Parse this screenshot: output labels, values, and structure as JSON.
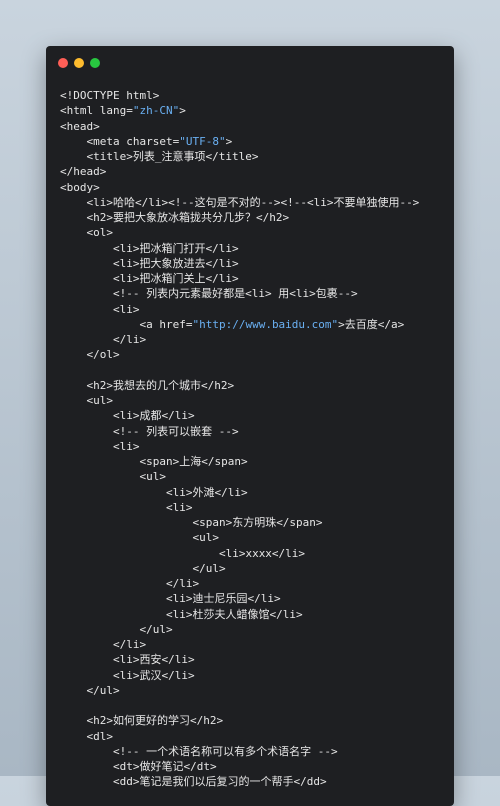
{
  "window": {
    "controls": {
      "close": "red-dot",
      "minimize": "yellow-dot",
      "maximize": "green-dot"
    },
    "colors": {
      "background": "#1e1f22",
      "text": "#e6e6e6",
      "string": "#6ab0f3"
    }
  },
  "code_lines": [
    {
      "indent": 0,
      "parts": [
        {
          "t": "<!DOCTYPE html>"
        }
      ]
    },
    {
      "indent": 0,
      "parts": [
        {
          "t": "<html lang="
        },
        {
          "t": "\"zh-CN\"",
          "s": 1
        },
        {
          "t": ">"
        }
      ]
    },
    {
      "indent": 0,
      "parts": [
        {
          "t": "<head>"
        }
      ]
    },
    {
      "indent": 1,
      "parts": [
        {
          "t": "<meta charset="
        },
        {
          "t": "\"UTF-8\"",
          "s": 1
        },
        {
          "t": ">"
        }
      ]
    },
    {
      "indent": 1,
      "parts": [
        {
          "t": "<title>列表_注意事项</title>"
        }
      ]
    },
    {
      "indent": 0,
      "parts": [
        {
          "t": "</head>"
        }
      ]
    },
    {
      "indent": 0,
      "parts": [
        {
          "t": "<body>"
        }
      ]
    },
    {
      "indent": 1,
      "parts": [
        {
          "t": "<li>哈哈</li><!--这句是不对的--><!--<li>不要单独使用-->"
        }
      ]
    },
    {
      "indent": 1,
      "parts": [
        {
          "t": "<h2>要把大象放冰箱拢共分几步？</h2>"
        }
      ]
    },
    {
      "indent": 1,
      "parts": [
        {
          "t": "<ol>"
        }
      ]
    },
    {
      "indent": 2,
      "parts": [
        {
          "t": "<li>把冰箱门打开</li>"
        }
      ]
    },
    {
      "indent": 2,
      "parts": [
        {
          "t": "<li>把大象放进去</li>"
        }
      ]
    },
    {
      "indent": 2,
      "parts": [
        {
          "t": "<li>把冰箱门关上</li>"
        }
      ]
    },
    {
      "indent": 2,
      "parts": [
        {
          "t": "<!-- 列表内元素最好都是<li> 用<li>包裹-->"
        }
      ]
    },
    {
      "indent": 2,
      "parts": [
        {
          "t": "<li>"
        }
      ]
    },
    {
      "indent": 3,
      "parts": [
        {
          "t": "<a href="
        },
        {
          "t": "\"http://www.baidu.com\"",
          "s": 1
        },
        {
          "t": ">去百度</a>"
        }
      ]
    },
    {
      "indent": 2,
      "parts": [
        {
          "t": "</li>"
        }
      ]
    },
    {
      "indent": 1,
      "parts": [
        {
          "t": "</ol>"
        }
      ]
    },
    {
      "indent": 0,
      "parts": [
        {
          "t": ""
        }
      ]
    },
    {
      "indent": 1,
      "parts": [
        {
          "t": "<h2>我想去的几个城市</h2>"
        }
      ]
    },
    {
      "indent": 1,
      "parts": [
        {
          "t": "<ul>"
        }
      ]
    },
    {
      "indent": 2,
      "parts": [
        {
          "t": "<li>成都</li>"
        }
      ]
    },
    {
      "indent": 2,
      "parts": [
        {
          "t": "<!-- 列表可以嵌套 -->"
        }
      ]
    },
    {
      "indent": 2,
      "parts": [
        {
          "t": "<li>"
        }
      ]
    },
    {
      "indent": 3,
      "parts": [
        {
          "t": "<span>上海</span>"
        }
      ]
    },
    {
      "indent": 3,
      "parts": [
        {
          "t": "<ul>"
        }
      ]
    },
    {
      "indent": 4,
      "parts": [
        {
          "t": "<li>外滩</li>"
        }
      ]
    },
    {
      "indent": 4,
      "parts": [
        {
          "t": "<li>"
        }
      ]
    },
    {
      "indent": 5,
      "parts": [
        {
          "t": "<span>东方明珠</span>"
        }
      ]
    },
    {
      "indent": 5,
      "parts": [
        {
          "t": "<ul>"
        }
      ]
    },
    {
      "indent": 6,
      "parts": [
        {
          "t": "<li>xxxx</li>"
        }
      ]
    },
    {
      "indent": 5,
      "parts": [
        {
          "t": "</ul>"
        }
      ]
    },
    {
      "indent": 4,
      "parts": [
        {
          "t": "</li>"
        }
      ]
    },
    {
      "indent": 4,
      "parts": [
        {
          "t": "<li>迪士尼乐园</li>"
        }
      ]
    },
    {
      "indent": 4,
      "parts": [
        {
          "t": "<li>杜莎夫人蜡像馆</li>"
        }
      ]
    },
    {
      "indent": 3,
      "parts": [
        {
          "t": "</ul>"
        }
      ]
    },
    {
      "indent": 2,
      "parts": [
        {
          "t": "</li>"
        }
      ]
    },
    {
      "indent": 2,
      "parts": [
        {
          "t": "<li>西安</li>"
        }
      ]
    },
    {
      "indent": 2,
      "parts": [
        {
          "t": "<li>武汉</li>"
        }
      ]
    },
    {
      "indent": 1,
      "parts": [
        {
          "t": "</ul>"
        }
      ]
    },
    {
      "indent": 0,
      "parts": [
        {
          "t": ""
        }
      ]
    },
    {
      "indent": 1,
      "parts": [
        {
          "t": "<h2>如何更好的学习</h2>"
        }
      ]
    },
    {
      "indent": 1,
      "parts": [
        {
          "t": "<dl>"
        }
      ]
    },
    {
      "indent": 2,
      "parts": [
        {
          "t": "<!-- 一个术语名称可以有多个术语名字 -->"
        }
      ]
    },
    {
      "indent": 2,
      "parts": [
        {
          "t": "<dt>做好笔记</dt>"
        }
      ]
    },
    {
      "indent": 2,
      "parts": [
        {
          "t": "<dd>笔记是我们以后复习的一个帮手</dd>"
        }
      ]
    }
  ]
}
